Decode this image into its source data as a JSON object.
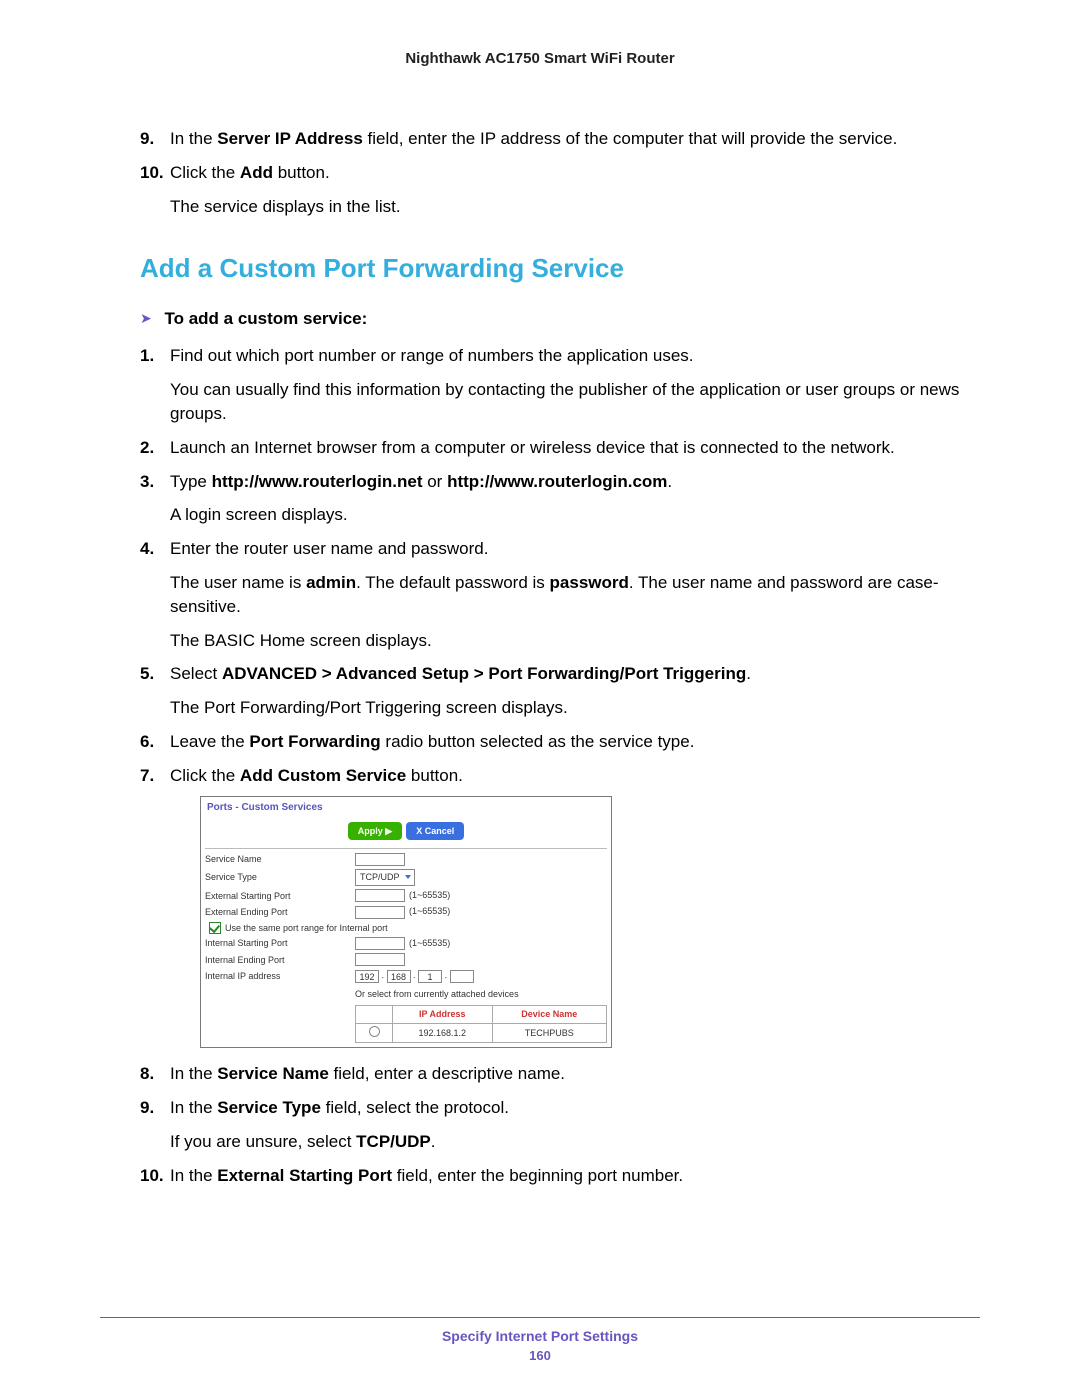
{
  "header": {
    "title": "Nighthawk AC1750 Smart WiFi Router"
  },
  "top_list": [
    {
      "num": "9.",
      "parts": [
        {
          "t": "In the ",
          "b": false
        },
        {
          "t": "Server IP Address",
          "b": true
        },
        {
          "t": " field, enter the IP address of the computer that will provide the service.",
          "b": false
        }
      ]
    },
    {
      "num": "10.",
      "parts": [
        {
          "t": "Click the ",
          "b": false
        },
        {
          "t": "Add",
          "b": true
        },
        {
          "t": " button.",
          "b": false
        }
      ],
      "sub": "The service displays in the list."
    }
  ],
  "section_heading": "Add a Custom Port Forwarding Service",
  "intro": "To add a custom service:",
  "steps": [
    {
      "num": "1.",
      "parts": [
        {
          "t": "Find out which port number or range of numbers the application uses.",
          "b": false
        }
      ],
      "sub": "You can usually find this information by contacting the publisher of the application or user groups or news groups."
    },
    {
      "num": "2.",
      "parts": [
        {
          "t": "Launch an Internet browser from a computer or wireless device that is connected to the network.",
          "b": false
        }
      ]
    },
    {
      "num": "3.",
      "parts": [
        {
          "t": "Type ",
          "b": false
        },
        {
          "t": "http://www.routerlogin.net",
          "b": true
        },
        {
          "t": " or ",
          "b": false
        },
        {
          "t": "http://www.routerlogin.com",
          "b": true
        },
        {
          "t": ".",
          "b": false
        }
      ],
      "sub": "A login screen displays."
    },
    {
      "num": "4.",
      "parts": [
        {
          "t": "Enter the router user name and password.",
          "b": false
        }
      ],
      "sub_parts": [
        {
          "t": "The user name is ",
          "b": false
        },
        {
          "t": "admin",
          "b": true
        },
        {
          "t": ". The default password is ",
          "b": false
        },
        {
          "t": "password",
          "b": true
        },
        {
          "t": ". The user name and password are case-sensitive.",
          "b": false
        }
      ],
      "sub2": "The BASIC Home screen displays."
    },
    {
      "num": "5.",
      "parts": [
        {
          "t": "Select ",
          "b": false
        },
        {
          "t": "ADVANCED > Advanced Setup > Port Forwarding/Port Triggering",
          "b": true
        },
        {
          "t": ".",
          "b": false
        }
      ],
      "sub": "The Port Forwarding/Port Triggering screen displays."
    },
    {
      "num": "6.",
      "parts": [
        {
          "t": "Leave the ",
          "b": false
        },
        {
          "t": "Port Forwarding",
          "b": true
        },
        {
          "t": " radio button selected as the service type.",
          "b": false
        }
      ]
    },
    {
      "num": "7.",
      "parts": [
        {
          "t": "Click the ",
          "b": false
        },
        {
          "t": "Add Custom Service",
          "b": true
        },
        {
          "t": " button.",
          "b": false
        }
      ]
    },
    {
      "num": "8.",
      "parts": [
        {
          "t": "In the ",
          "b": false
        },
        {
          "t": "Service Name",
          "b": true
        },
        {
          "t": " field, enter a descriptive name.",
          "b": false
        }
      ]
    },
    {
      "num": "9.",
      "parts": [
        {
          "t": "In the ",
          "b": false
        },
        {
          "t": "Service Type",
          "b": true
        },
        {
          "t": " field, select the protocol.",
          "b": false
        }
      ],
      "sub_parts": [
        {
          "t": "If you are unsure, select ",
          "b": false
        },
        {
          "t": "TCP/UDP",
          "b": true
        },
        {
          "t": ".",
          "b": false
        }
      ]
    },
    {
      "num": "10.",
      "parts": [
        {
          "t": "In the ",
          "b": false
        },
        {
          "t": "External Starting Port",
          "b": true
        },
        {
          "t": " field, enter the beginning port number.",
          "b": false
        }
      ]
    }
  ],
  "shot": {
    "title": "Ports - Custom Services",
    "apply": "Apply ▶",
    "cancel": "X Cancel",
    "labels": {
      "service_name": "Service Name",
      "service_type": "Service Type",
      "ext_start": "External Starting Port",
      "ext_end": "External Ending Port",
      "same_range": "Use the same port range for Internal port",
      "int_start": "Internal Starting Port",
      "int_end": "Internal Ending Port",
      "int_ip": "Internal IP address",
      "or_select": "Or select from currently attached devices"
    },
    "service_type_value": "TCP/UDP",
    "port_range": "(1~65535)",
    "ip": {
      "a": "192",
      "b": "168",
      "c": "1",
      "d": ""
    },
    "table": {
      "headers": [
        "",
        "IP Address",
        "Device Name"
      ],
      "row": [
        "",
        "192.168.1.2",
        "TECHPUBS"
      ]
    }
  },
  "footer": {
    "text": "Specify Internet Port Settings",
    "page": "160"
  }
}
